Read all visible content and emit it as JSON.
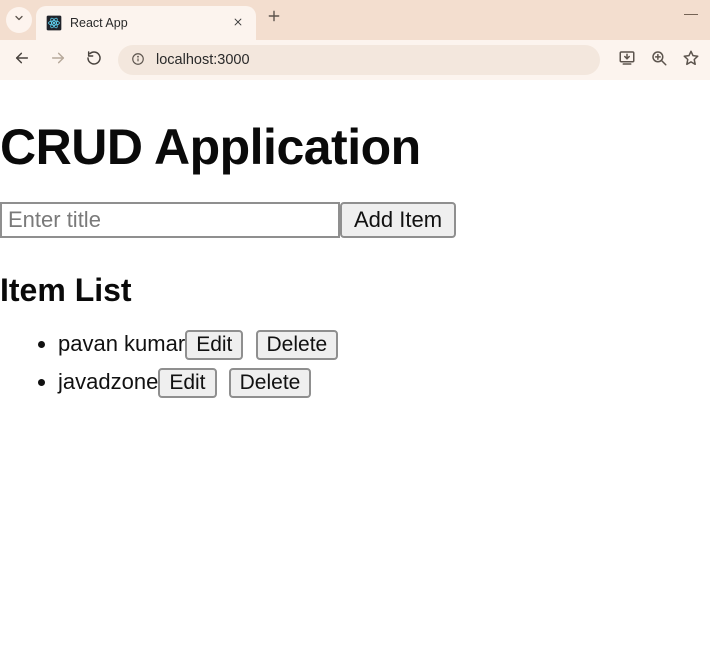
{
  "browser": {
    "tab_title": "React App",
    "url": "localhost:3000"
  },
  "app": {
    "heading": "CRUD Application",
    "input_placeholder": "Enter title",
    "add_button_label": "Add Item",
    "list_heading": "Item List",
    "edit_label": "Edit",
    "delete_label": "Delete",
    "items": [
      {
        "title": "pavan kumar"
      },
      {
        "title": "javadzone"
      }
    ]
  }
}
